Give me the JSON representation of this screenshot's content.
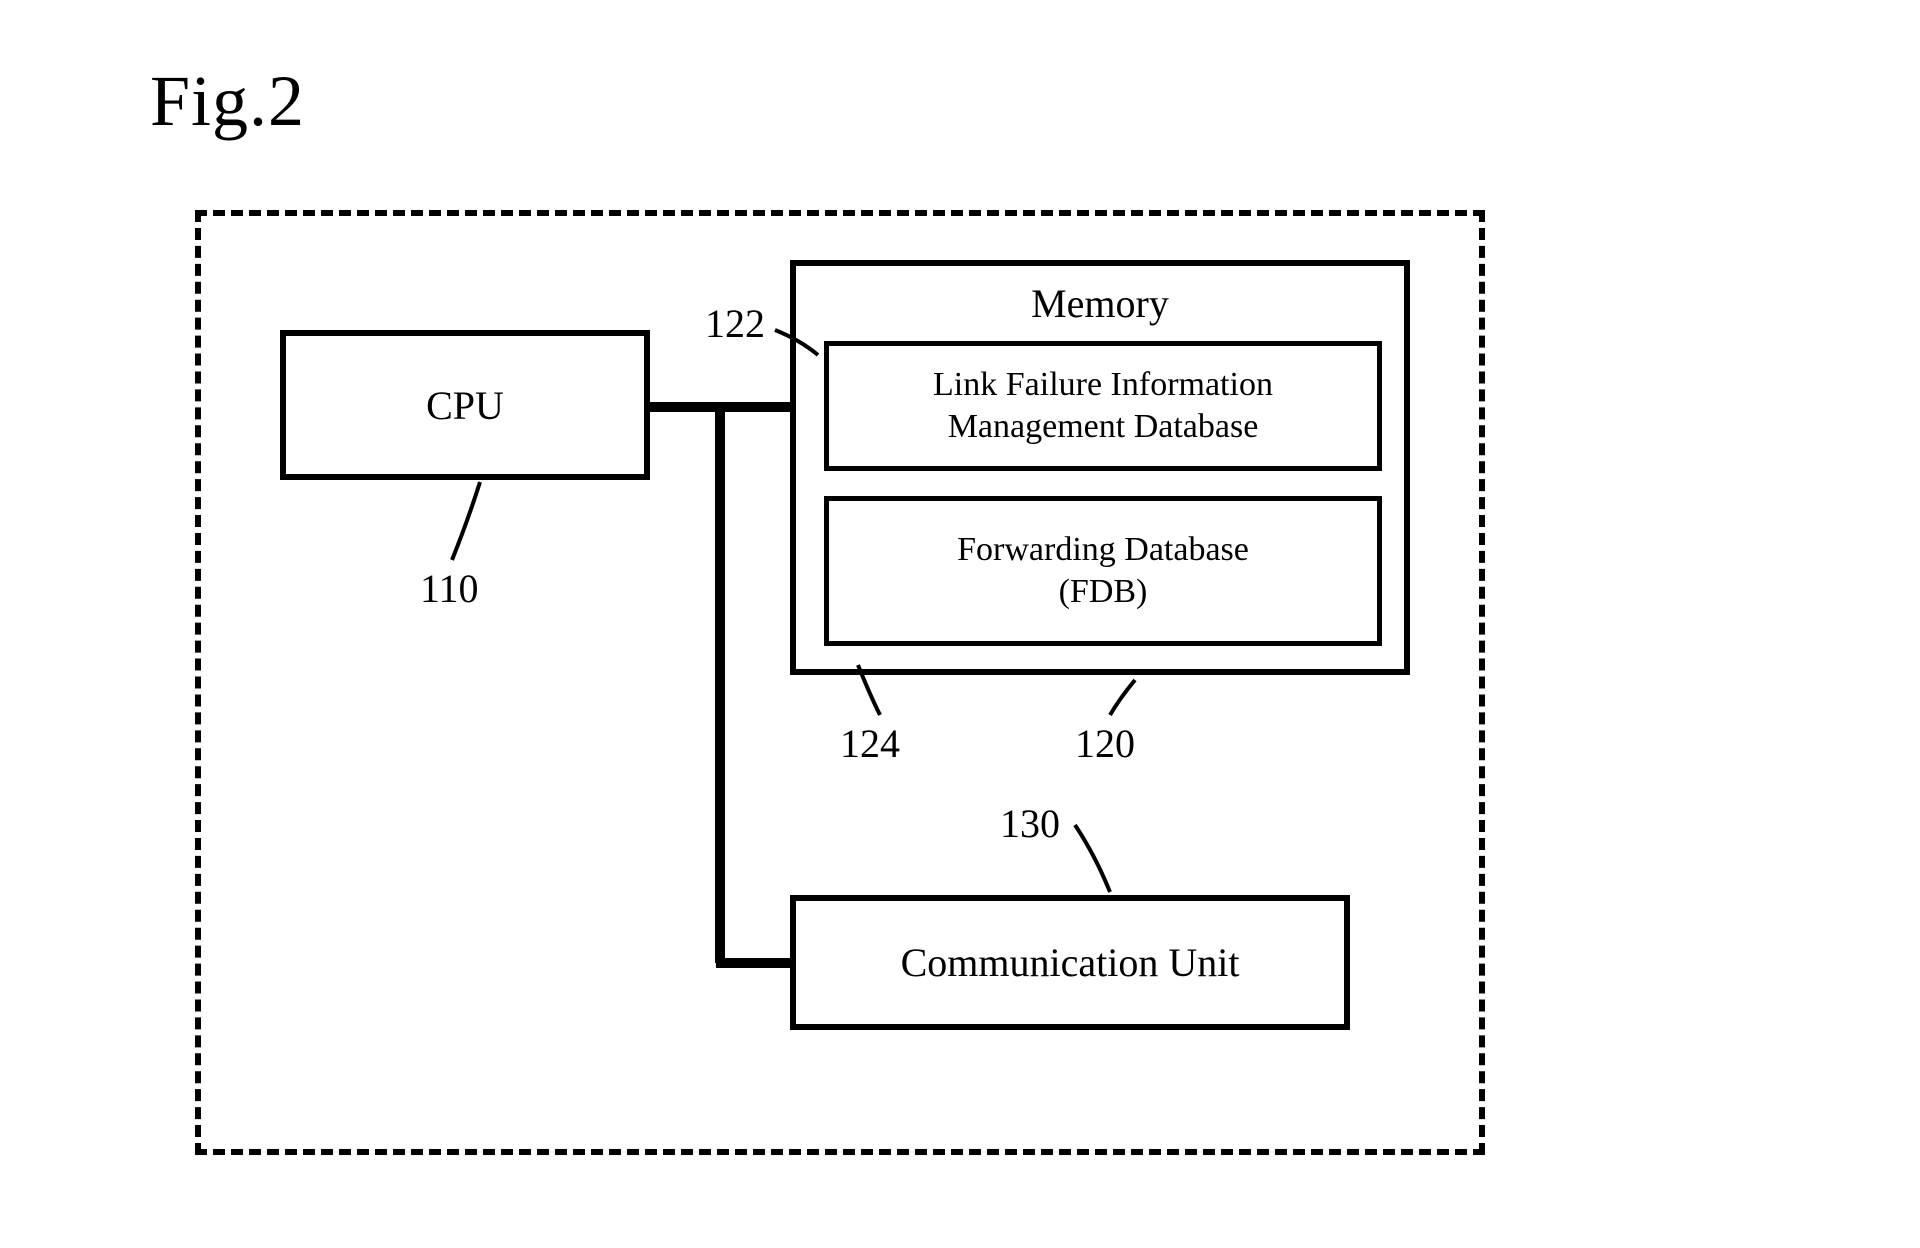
{
  "figure": {
    "title": "Fig.2",
    "cpu": {
      "label": "CPU",
      "ref": "110"
    },
    "memory": {
      "title": "Memory",
      "ref": "120",
      "link_failure_db": {
        "label_line1": "Link Failure Information",
        "label_line2": "Management Database",
        "ref": "122"
      },
      "fdb": {
        "label_line1": "Forwarding Database",
        "label_line2": "(FDB)",
        "ref": "124"
      }
    },
    "comm_unit": {
      "label": "Communication Unit",
      "ref": "130"
    }
  }
}
